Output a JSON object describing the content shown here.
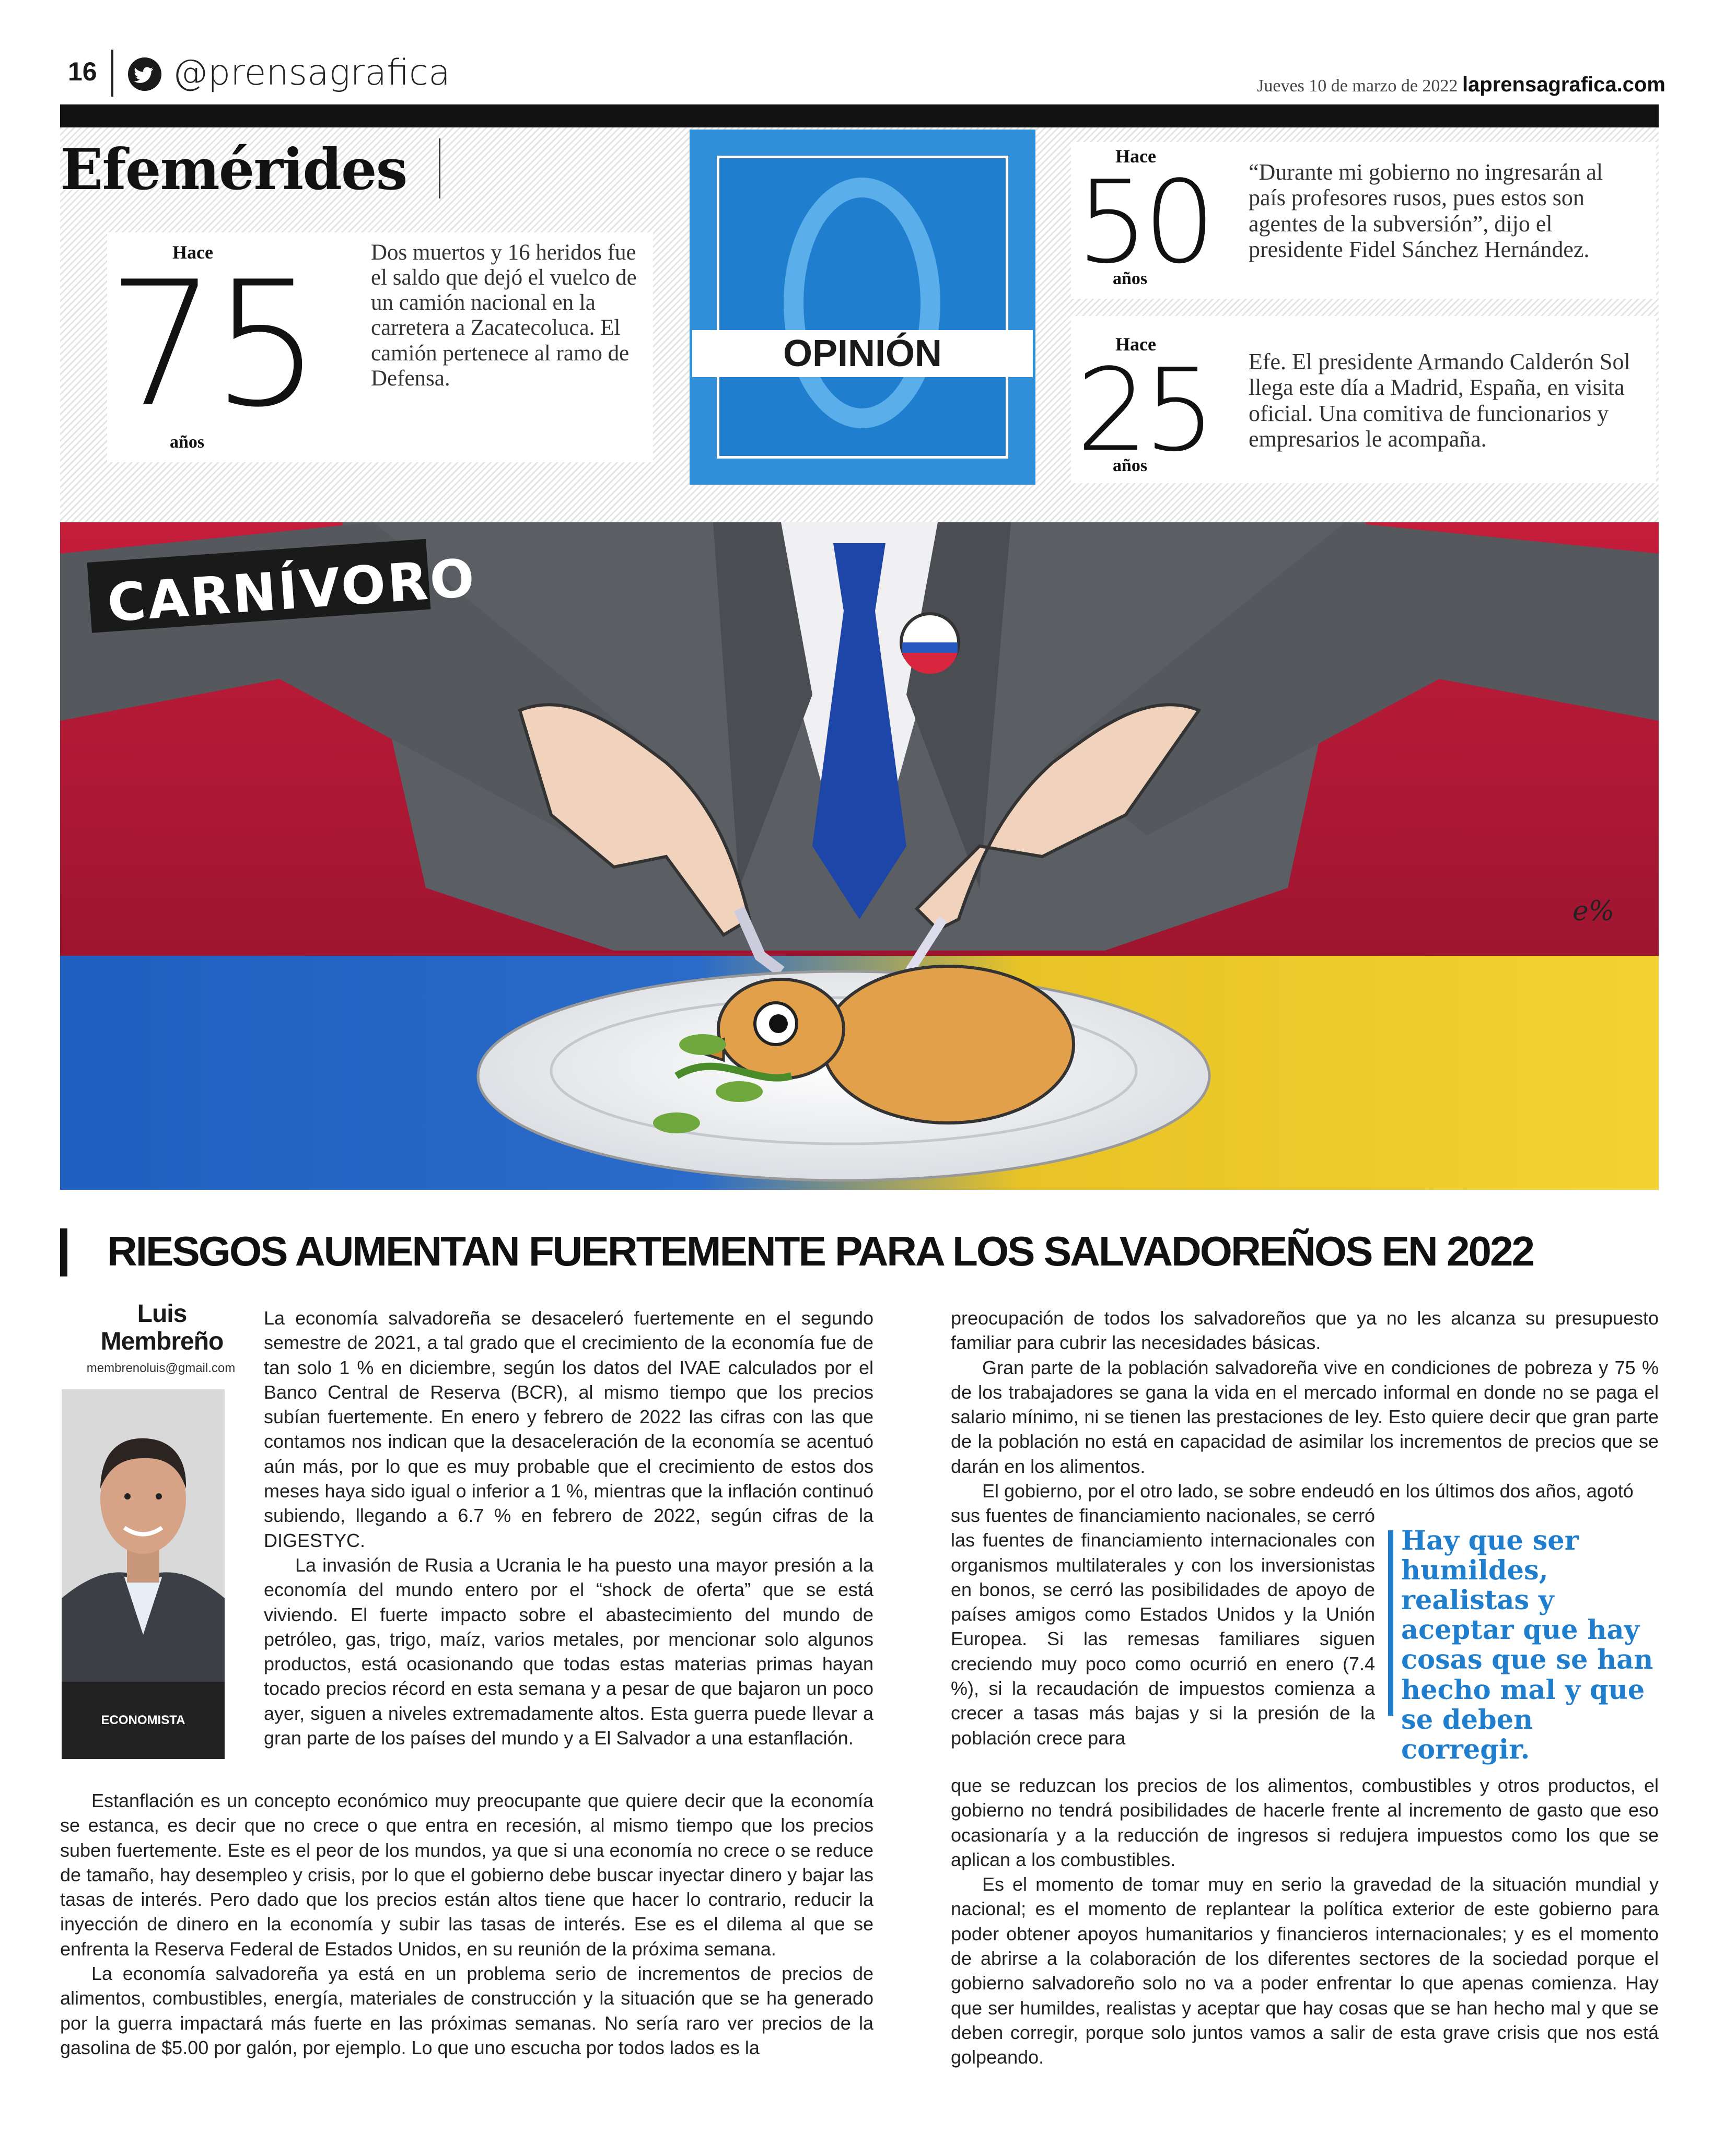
{
  "header": {
    "page_number": "16",
    "twitter_handle": "@prensagrafica",
    "date": "Jueves 10 de marzo de 2022",
    "site": "laprensagrafica.com"
  },
  "efemerides": {
    "title": "Efemérides",
    "hace_label": "Hace",
    "anos_label": "años",
    "items": [
      {
        "years": "75",
        "text": "Dos muertos y 16 heridos fue el saldo que dejó el vuelco de un camión nacional en la carretera a Zacatecoluca. El camión pertenece al ramo de Defensa."
      },
      {
        "years": "50",
        "text": "“Durante mi gobierno no ingresarán al país profesores rusos, pues estos son agentes de la subversión”, dijo el presidente Fidel Sánchez Hernández."
      },
      {
        "years": "25",
        "text": "Efe. El presidente Armando Calderón Sol llega este día a Madrid, España, en visita oficial. Una comitiva de funcionarios y empresarios le acompaña."
      }
    ]
  },
  "opinion": {
    "letter": "O",
    "label": "OPINIÓN"
  },
  "cartoon": {
    "title": "CARNÍVORO",
    "signature": "e%"
  },
  "article": {
    "headline": "RIESGOS AUMENTAN FUERTEMENTE PARA LOS SALVADOREÑOS EN 2022",
    "author_first": "Luis",
    "author_last": "Membreño",
    "author_email": "membrenoluis@gmail.com",
    "author_role": "ECONOMISTA",
    "col1_p1": "La economía salvadoreña se desaceleró fuertemente en el segundo semestre de 2021, a tal grado que el crecimiento de la economía fue de tan solo 1 % en diciembre, según los datos del IVAE calculados por el Banco Central de Reserva (BCR), al mismo tiempo que los precios subían fuertemente. En enero y febrero de 2022 las cifras con las que contamos nos indican que la desaceleración de la economía se acentuó aún más, por lo que es muy probable que el crecimiento de estos dos meses haya sido igual o inferior a 1 %, mientras que la inflación continuó subiendo, llegando a 6.7 % en febrero de 2022, según cifras de la DIGESTYC.",
    "col1_p2": "La invasión de Rusia a Ucrania le ha puesto una mayor presión a la economía del mundo entero por el “shock de oferta” que se está viviendo. El fuerte impacto sobre el abastecimiento del mundo de petróleo, gas, trigo, maíz, varios metales, por mencionar solo algunos productos, está ocasionando que todas estas materias primas hayan tocado precios récord en esta semana y a pesar de que bajaron un poco ayer, siguen a niveles extremadamente altos. Esta guerra puede llevar a gran parte de los países del mundo y a El Salvador a una estanflación.",
    "col1_p3": "Estanflación es un concepto económico muy preocupante que quiere decir que la economía se estanca, es decir que no crece o que entra en recesión, al mismo tiempo que los precios suben fuertemente. Este es el peor de los mundos, ya que si una economía no crece o se reduce de tamaño, hay desempleo y crisis, por lo que el gobierno debe buscar inyectar dinero y bajar las tasas de interés. Pero dado que los precios están altos tiene que hacer lo contrario, reducir la inyección de dinero en la economía y subir las tasas de interés. Ese es el dilema al que se enfrenta la Reserva Federal de Estados Unidos, en su reunión de la próxima semana.",
    "col1_p4": "La economía salvadoreña ya está en un problema serio de incrementos de precios de alimentos, combustibles, energía, materiales de construcción y la situación que se ha generado por la guerra impactará más fuerte en las próximas semanas. No sería raro ver precios de la gasolina de $5.00 por galón, por ejemplo. Lo que uno escucha por todos lados es la",
    "col2_p1": "preocupación de todos los salvadoreños que ya no les alcanza su presupuesto familiar para cubrir las necesidades básicas.",
    "col2_p2": "Gran parte de la población salvadoreña vive en condiciones de pobreza y 75 % de los trabajadores se gana la vida en el mercado informal en donde no se paga el salario mínimo, ni se tienen las prestaciones de ley. Esto quiere decir que gran parte de la población no está en capacidad de asimilar los incrementos de precios que se darán en los alimentos.",
    "col2_p3a": "El gobierno, por el otro lado, se sobre endeudó en los últimos dos años, agotó",
    "col2_p3b": "sus fuentes de financiamiento nacionales, se cerró las fuentes de financiamiento internacionales con organismos multilaterales y con los inversionistas en bonos, se cerró las posibilidades de apoyo de países amigos como Estados Unidos y la Unión Europea. Si las remesas familiares siguen creciendo muy poco como ocurrió en enero (7.4 %), si la recaudación de impuestos comienza a crecer a tasas más bajas y si la presión de la población crece para",
    "col2_p3c": "que se reduzcan los precios de los alimentos, combustibles y otros productos, el gobierno no tendrá posibilidades de hacerle frente al incremento de gasto que eso ocasionaría y a la reducción de ingresos si redujera impuestos como los que se aplican a los combustibles.",
    "col2_p4": "Es el momento de tomar muy en serio la gravedad de la situación mundial y nacional; es el momento de replantear la política exterior de este gobierno para poder obtener apoyos humanitarios y financieros internacionales; y es el momento de abrirse a la colaboración de los diferentes sectores de la sociedad porque el gobierno salvadoreño solo no va a poder enfrentar lo que apenas comienza. Hay que ser humildes, realistas y aceptar que hay cosas que se han hecho mal y que se deben corregir, porque solo juntos vamos a salir de esta grave crisis que nos está golpeando.",
    "pull_quote": "Hay que ser humildes, realistas y aceptar que hay cosas que se han hecho mal y que se deben corregir."
  }
}
